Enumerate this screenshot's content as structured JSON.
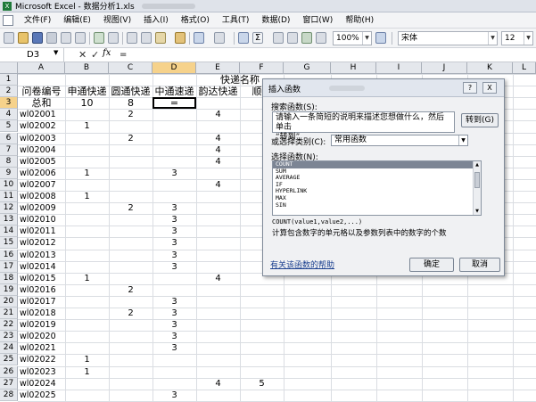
{
  "window": {
    "title": "Microsoft Excel - 数据分析1.xls"
  },
  "menu": [
    "文件(F)",
    "编辑(E)",
    "视图(V)",
    "插入(I)",
    "格式(O)",
    "工具(T)",
    "数据(D)",
    "窗口(W)",
    "帮助(H)"
  ],
  "toolbar": {
    "zoom": "100%",
    "font": "宋体",
    "size": "12"
  },
  "formula_bar": {
    "name_box": "D3",
    "content": "="
  },
  "columns": [
    "A",
    "B",
    "C",
    "D",
    "E",
    "F",
    "G",
    "H",
    "I",
    "J",
    "K",
    "L"
  ],
  "rows": [
    "1",
    "2",
    "3",
    "4",
    "5",
    "6",
    "7",
    "8",
    "9",
    "10",
    "11",
    "12",
    "13",
    "14",
    "15",
    "16",
    "17",
    "18",
    "19",
    "20",
    "21",
    "22",
    "23",
    "24",
    "25",
    "26",
    "27",
    "28"
  ],
  "sheet": {
    "merged_header": "快递名称",
    "headers": [
      "问卷编号",
      "申通快递",
      "圆通快递",
      "中通速递",
      "韵达快递",
      "顺丰"
    ],
    "totals": [
      "总和",
      "10",
      "8",
      "="
    ],
    "ids": [
      "wl02001",
      "wl02002",
      "wl02003",
      "wl02004",
      "wl02005",
      "wl02006",
      "wl02007",
      "wl02008",
      "wl02009",
      "wl02010",
      "wl02011",
      "wl02012",
      "wl02013",
      "wl02014",
      "wl02015",
      "wl02016",
      "wl02017",
      "wl02018",
      "wl02019",
      "wl02020",
      "wl02021",
      "wl02022",
      "wl02023",
      "wl02024",
      "wl02025"
    ],
    "colB": [
      "",
      "1",
      "",
      "",
      "",
      "1",
      "",
      "1",
      "",
      "",
      "",
      "",
      "",
      "",
      "1",
      "",
      "",
      "",
      "",
      "",
      "",
      "1",
      "1",
      "",
      ""
    ],
    "colC": [
      "2",
      "",
      "2",
      "",
      "",
      "",
      "",
      "",
      "2",
      "",
      "",
      "",
      "",
      "",
      "",
      "2",
      "",
      "2",
      "",
      "",
      "",
      "",
      "",
      "",
      ""
    ],
    "colD": [
      "",
      "",
      "",
      "",
      "",
      "3",
      "",
      "",
      "3",
      "3",
      "3",
      "3",
      "3",
      "3",
      "",
      "",
      "3",
      "3",
      "3",
      "3",
      "3",
      "",
      "",
      "",
      "3"
    ],
    "colE": [
      "4",
      "",
      "4",
      "4",
      "4",
      "",
      "4",
      "",
      "",
      "",
      "",
      "",
      "",
      "",
      "4",
      "",
      "",
      "",
      "",
      "",
      "",
      "",
      "",
      "4",
      ""
    ],
    "colF": [
      "",
      "",
      "",
      "",
      "",
      "",
      "",
      "",
      "",
      "",
      "",
      "",
      "",
      "",
      "",
      "",
      "",
      "",
      "",
      "",
      "",
      "",
      "",
      "5",
      ""
    ]
  },
  "dialog": {
    "title": "插入函数",
    "search_label": "搜索函数(S):",
    "search_text_1": "请输入一条简短的说明来描述您想做什么，然后单击",
    "search_text_2": "“转到”",
    "goto_button": "转到(G)",
    "category_label": "或选择类别(C):",
    "category_value": "常用函数",
    "select_label": "选择函数(N):",
    "functions": [
      "COUNT",
      "SUM",
      "AVERAGE",
      "IF",
      "HYPERLINK",
      "MAX",
      "SIN"
    ],
    "selected": "COUNT",
    "signature": "COUNT(value1,value2,...)",
    "description": "计算包含数字的单元格以及参数列表中的数字的个数",
    "help_link": "有关该函数的帮助",
    "ok": "确定",
    "cancel": "取消",
    "help_glyph": "?",
    "close_glyph": "X"
  }
}
